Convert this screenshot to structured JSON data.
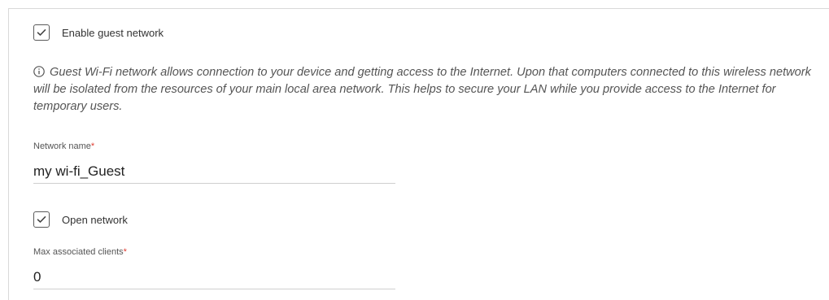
{
  "guest_network": {
    "enable_label": "Enable guest network",
    "enable_checked": true,
    "info_text": "Guest Wi-Fi network allows connection to your device and getting access to the Internet. Upon that computers connected to this wireless network will be isolated from the resources of your main local area network. This helps to secure your LAN while you provide access to the Internet for temporary users.",
    "network_name": {
      "label": "Network name",
      "required_mark": "*",
      "value": "my wi-fi_Guest"
    },
    "open_network": {
      "label": "Open network",
      "checked": true
    },
    "max_clients": {
      "label": "Max associated clients",
      "required_mark": "*",
      "value": "0"
    }
  },
  "icons": {
    "checkbox_check": "check-icon",
    "info": "info-icon"
  },
  "colors": {
    "required": "#e03c31",
    "text": "#333333",
    "border": "#cfcfcf"
  }
}
